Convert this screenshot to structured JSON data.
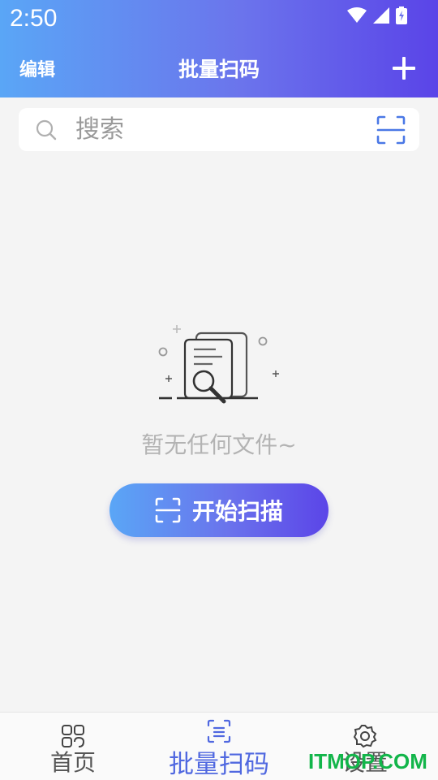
{
  "status_bar": {
    "time": "2:50",
    "icons": [
      "wifi-icon",
      "signal-icon",
      "battery-charging-icon"
    ]
  },
  "nav": {
    "edit_label": "编辑",
    "title": "批量扫码",
    "add_icon": "plus-icon"
  },
  "search": {
    "placeholder": "搜索",
    "left_icon": "search-icon",
    "right_icon": "scan-icon"
  },
  "empty_state": {
    "illustration": "document-search-illustration",
    "message": "暂无任何文件~"
  },
  "start_button": {
    "label": "开始扫描",
    "icon": "scan-icon"
  },
  "tabbar": {
    "tabs": [
      {
        "label": "首页",
        "icon": "grid-icon",
        "active": false
      },
      {
        "label": "批量扫码",
        "icon": "scan-list-icon",
        "active": true
      },
      {
        "label": "设置",
        "icon": "gear-icon",
        "active": false
      }
    ]
  },
  "watermark": "ITMOP.COM",
  "colors": {
    "gradient_start": "#5aa6f6",
    "gradient_end": "#5a44e8",
    "active_tab": "#5068e0",
    "background": "#f4f4f4"
  }
}
